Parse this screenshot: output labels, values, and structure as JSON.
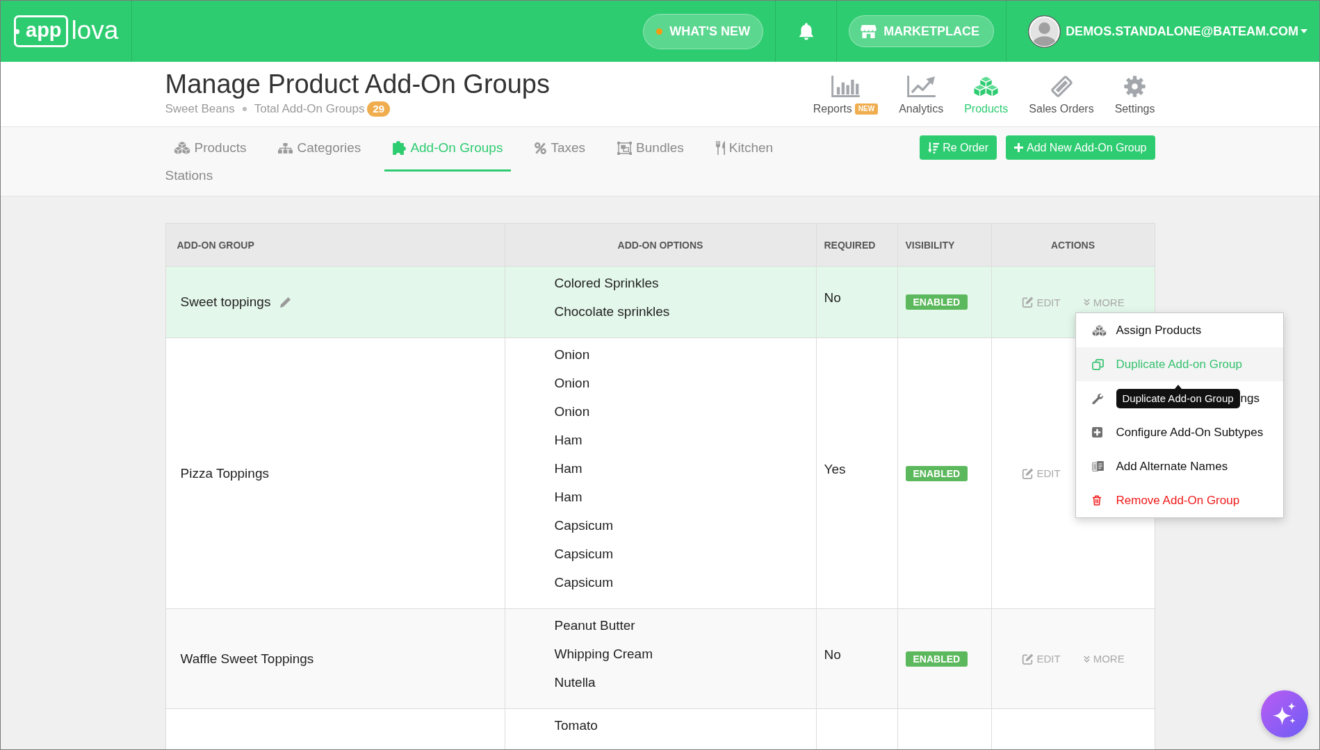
{
  "header": {
    "logo": {
      "mark": "app",
      "word": "lova"
    },
    "whats_new": {
      "label": "WHAT'S NEW",
      "unread": true
    },
    "marketplace": {
      "label": "MARKETPLACE"
    },
    "user": {
      "email": "DEMOS.STANDALONE@BATEAM.COM"
    }
  },
  "page": {
    "title": "Manage Product Add-On Groups",
    "store": "Sweet Beans",
    "total_label": "Total Add-On Groups",
    "total_count": "29"
  },
  "main_nav": [
    {
      "label": "Reports",
      "kind": "bars",
      "badge": "NEW",
      "selected": false
    },
    {
      "label": "Analytics",
      "kind": "trend",
      "selected": false
    },
    {
      "label": "Products",
      "kind": "boxes",
      "selected": true
    },
    {
      "label": "Sales Orders",
      "kind": "ticket",
      "selected": false
    },
    {
      "label": "Settings",
      "kind": "gear",
      "selected": false
    }
  ],
  "tabs": [
    {
      "label": "Products",
      "kind": "boxes",
      "selected": false
    },
    {
      "label": "Categories",
      "kind": "sitemap",
      "selected": false
    },
    {
      "label": "Add-On Groups",
      "kind": "puzzle",
      "selected": true
    },
    {
      "label": "Taxes",
      "kind": "percent",
      "selected": false
    },
    {
      "label": "Bundles",
      "kind": "bundle",
      "selected": false
    },
    {
      "label": "Kitchen Stations",
      "kind": "cutlery",
      "selected": false
    }
  ],
  "actions": [
    {
      "label": "Re Order",
      "kind": "sort"
    },
    {
      "label": "Add New Add-On Group",
      "kind": "plus"
    }
  ],
  "table": {
    "columns": [
      "ADD-ON GROUP",
      "ADD-ON OPTIONS",
      "REQUIRED",
      "VISIBILITY",
      "ACTIONS"
    ],
    "rows": [
      {
        "name": "Sweet toppings",
        "selected": true,
        "options": [
          "Colored Sprinkles",
          "Chocolate sprinkles"
        ],
        "required": "No",
        "visibility": "ENABLED",
        "actions": [
          {
            "label": "EDIT",
            "kind": "edit"
          },
          {
            "label": "MORE",
            "kind": "more"
          }
        ],
        "menu": {
          "items": [
            {
              "label": "Assign Products",
              "kind": "boxes",
              "selected": false,
              "danger": false
            },
            {
              "label": "Duplicate Add-on Group",
              "kind": "copy",
              "selected": true,
              "danger": false
            },
            {
              "label": "ngs",
              "kind": "wrench",
              "selected": false,
              "danger": false
            },
            {
              "label": "Configure Add-On Subtypes",
              "kind": "add",
              "selected": false,
              "danger": false
            },
            {
              "label": "Add Alternate Names",
              "kind": "translate",
              "selected": false,
              "danger": false
            },
            {
              "label": "Remove Add-On Group",
              "kind": "trash",
              "selected": false,
              "danger": true
            }
          ],
          "tooltip": "Duplicate Add-on Group"
        }
      },
      {
        "name": "Pizza Toppings",
        "selected": false,
        "options": [
          "Onion",
          "Onion",
          "Onion",
          "Ham",
          "Ham",
          "Ham",
          "Capsicum",
          "Capsicum",
          "Capsicum"
        ],
        "required": "Yes",
        "visibility": "ENABLED",
        "actions": [
          {
            "label": "EDIT",
            "kind": "edit"
          }
        ]
      },
      {
        "name": "Waffle Sweet Toppings",
        "selected": false,
        "options": [
          "Peanut Butter",
          "Whipping Cream",
          "Nutella"
        ],
        "required": "No",
        "visibility": "ENABLED",
        "actions": [
          {
            "label": "EDIT",
            "kind": "edit"
          },
          {
            "label": "MORE",
            "kind": "more"
          }
        ]
      },
      {
        "selected": false,
        "options": [
          "Tomato"
        ]
      }
    ]
  }
}
